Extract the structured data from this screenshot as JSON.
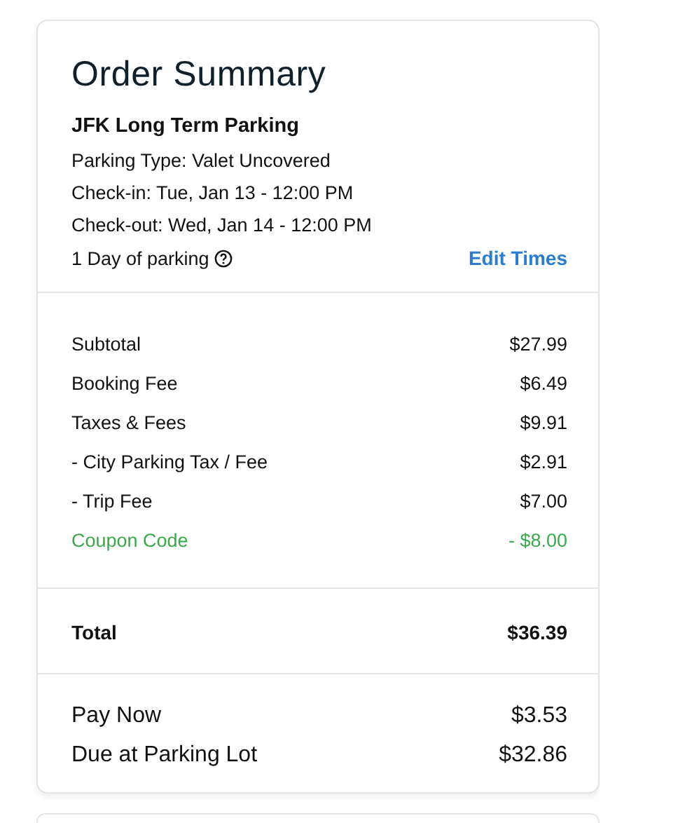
{
  "title": "Order Summary",
  "lot_name": "JFK Long Term Parking",
  "details": [
    "Parking Type: Valet Uncovered",
    "Check-in: Tue, Jan 13 - 12:00 PM",
    "Check-out: Wed, Jan 14 - 12:00 PM"
  ],
  "duration": "1 Day of parking",
  "edit_link": "Edit Times",
  "line_items": [
    {
      "label": "Subtotal",
      "amount": "$27.99",
      "kind": "charge"
    },
    {
      "label": "Booking Fee",
      "amount": "$6.49",
      "kind": "charge"
    },
    {
      "label": "Taxes & Fees",
      "amount": "$9.91",
      "kind": "charge"
    },
    {
      "label": "- City Parking Tax / Fee",
      "amount": "$2.91",
      "kind": "charge"
    },
    {
      "label": "- Trip Fee",
      "amount": "$7.00",
      "kind": "charge"
    },
    {
      "label": "Coupon Code",
      "amount": "- $8.00",
      "kind": "discount"
    }
  ],
  "total": {
    "label": "Total",
    "amount": "$36.39"
  },
  "payments": [
    {
      "label": "Pay Now",
      "amount": "$3.53"
    },
    {
      "label": "Due at Parking Lot",
      "amount": "$32.86"
    }
  ]
}
